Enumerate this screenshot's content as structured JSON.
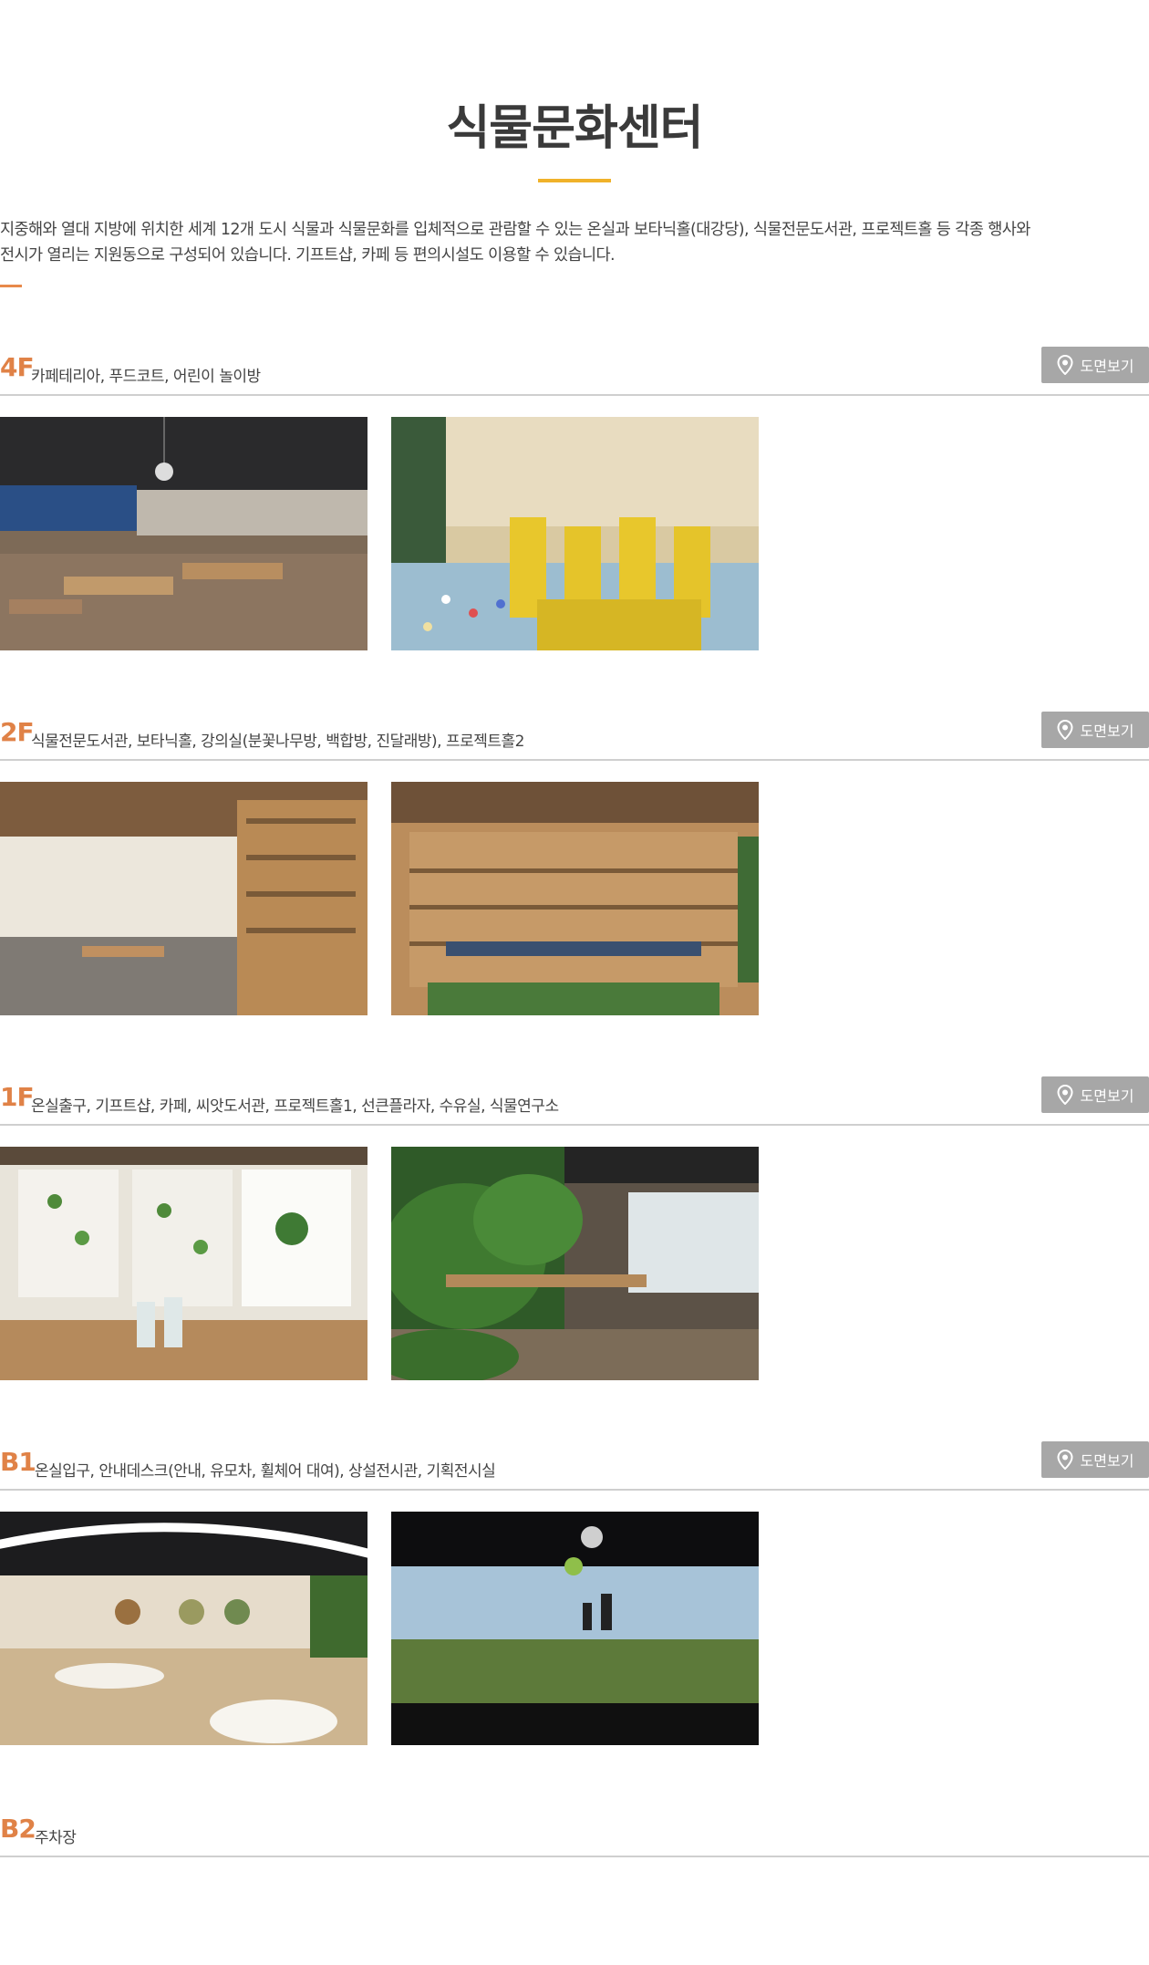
{
  "page": {
    "title": "식물문화센터",
    "intro": [
      "지중해와 열대 지방에 위치한 세계 12개 도시 식물과 식물문화를 입체적으로 관람할 수 있는 온실과 보타닉홀(대강당), 식물전문도서관, 프로젝트홀 등 각종 행사와",
      "전시가 열리는 지원동으로 구성되어 있습니다. 기프트샵, 카페 등 편의시설도 이용할 수 있습니다."
    ]
  },
  "floors": [
    {
      "code": "4F",
      "desc": "카페테리아, 푸드코트, 어린이 놀이방",
      "button": "도면보기"
    },
    {
      "code": "2F",
      "desc": "식물전문도서관, 보타닉홀, 강의실(분꽃나무방, 백합방, 진달래방), 프로젝트홀2",
      "button": "도면보기"
    },
    {
      "code": "1F",
      "desc": "온실출구, 기프트샵, 카페, 씨앗도서관, 프로젝트홀1, 선큰플라자, 수유실, 식물연구소",
      "button": "도면보기"
    },
    {
      "code": "B1",
      "desc": "온실입구, 안내데스크(안내, 유모차, 휠체어 대여), 상설전시관, 기획전시실",
      "button": "도면보기"
    },
    {
      "code": "B2",
      "desc": "주차장"
    }
  ],
  "icons": {
    "map": "map-pin-icon"
  },
  "colors": {
    "accent": "#e08247",
    "title_bar": "#f0b22a",
    "button": "#a7a7a7",
    "divider": "#cfcfcf"
  }
}
